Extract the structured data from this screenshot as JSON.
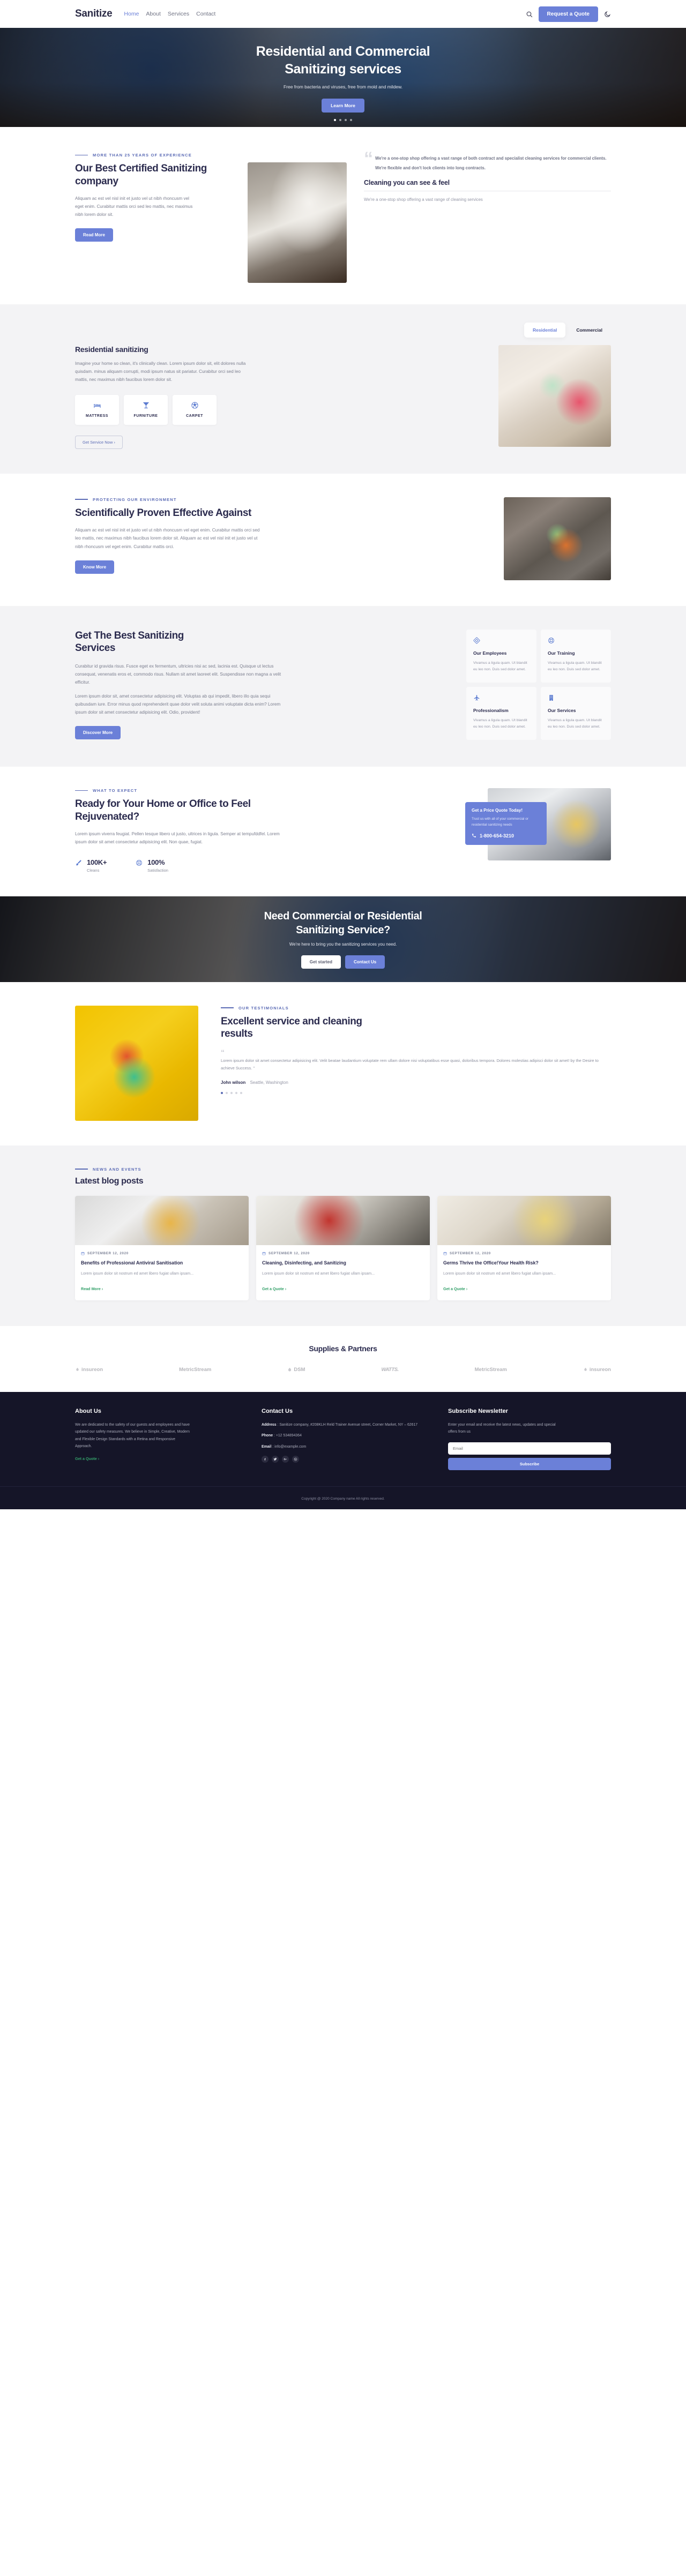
{
  "header": {
    "brand": "Sanitize",
    "nav": [
      {
        "label": "Home",
        "active": true
      },
      {
        "label": "About",
        "active": false
      },
      {
        "label": "Services",
        "active": false
      },
      {
        "label": "Contact",
        "active": false
      }
    ],
    "search_icon": "search-icon",
    "quote_button": "Request a Quote",
    "theme_icon": "moon-icon"
  },
  "hero": {
    "title_line1": "Residential and Commercial",
    "title_line2": "Sanitizing services",
    "subtitle": "Free from bacteria and viruses, free from mold and mildew.",
    "button": "Learn More",
    "slide_count": 4,
    "active_slide": 1
  },
  "about": {
    "eyebrow": "MORE THAN 25 YEARS OF EXPERIENCE",
    "title": "Our Best Certified Sanitizing company",
    "body": "Aliquam ac est vel nisl init et justo vel ut nibh rhoncusm vel eget enim. Curabitur mattis orci sed leo mattis, nec maximus nibh lorem dolor sit.",
    "button": "Read More",
    "quote_mark": "“",
    "quote": "We're a one-stop shop offering a vast range of both contract and specialist cleaning services for commercial clients. We're flexible and don't lock clients into long contracts.",
    "quote_heading": "Cleaning you can see & feel",
    "quote_sub": "We're a one-stop shop offering a vast range of cleaning services"
  },
  "residential": {
    "tabs": [
      {
        "label": "Residential",
        "active": true
      },
      {
        "label": "Commercial",
        "active": false
      }
    ],
    "title": "Residential sanitizing",
    "body": "Imagine your home so clean, it's clinically clean. Lorem ipsum dolor sit, elit dolores nulla quisdam. minus aliquam corrupti, modi ipsum natus sit pariatur. Curabitur orci sed leo mattis, nec maximus nibh faucibus lorem dolor sit.",
    "cards": [
      {
        "label": "MATTRESS",
        "icon": "bed-icon"
      },
      {
        "label": "FURNITURE",
        "icon": "cocktail-glass-icon"
      },
      {
        "label": "CARPET",
        "icon": "ball-icon"
      }
    ],
    "button": "Get Service Now ›"
  },
  "science": {
    "eyebrow": "PROTECTING OUR ENVIRONMENT",
    "title": "Scientifically Proven Effective Against",
    "body": "Aliquam ac est vel nisl init et justo vel ut nibh rhoncusm vel eget enim. Curabitur mattis orci sed leo mattis, nec maximus nibh faucibus lorem dolor sit. Aliquam ac est vel nisl init et justo vel ut nibh rhoncusm vel eget enim. Curabitur mattis orci.",
    "button": "Know More"
  },
  "best": {
    "title": "Get The Best Sanitizing Services",
    "body1": "Curabitur id gravida risus. Fusce eget ex fermentum, ultricies nisi ac sed, lacinia est. Quisque ut lectus consequat, venenatis eros et, commodo risus. Nullam sit amet laoreet elit. Suspendisse non magna a velit efficitur.",
    "body2": "Lorem ipsum dolor sit, amet consectetur adipisicing elit. Voluptas ab qui impedit, libero illo quia sequi quibusdam iure. Error minus quod reprehenderit quae dolor velit soluta animi voluptate dicta enim? Lorem ipsum dolor sit amet consectetur adipisicing elit. Odio, provident!",
    "button": "Discover More",
    "features": [
      {
        "icon": "diamond-icon",
        "title": "Our Employees",
        "text": "Vivamus a ligula quam. Ut blandit eu leo non. Duis sed dolor amet."
      },
      {
        "icon": "lifebuoy-icon",
        "title": "Our Training",
        "text": "Vivamus a ligula quam. Ut blandit eu leo non. Duis sed dolor amet."
      },
      {
        "icon": "plane-icon",
        "title": "Professionalism",
        "text": "Vivamus a ligula quam. Ut blandit eu leo non. Duis sed dolor amet."
      },
      {
        "icon": "building-icon",
        "title": "Our Services",
        "text": "Vivamus a ligula quam. Ut blandit eu leo non. Duis sed dolor amet."
      }
    ]
  },
  "ready": {
    "eyebrow": "WHAT TO EXPECT",
    "title": "Ready for Your Home or Office to Feel Rejuvenated?",
    "body": "Lorem ipsum viverra feugiat. Pellen tesque libero ut justo, ultrices in ligula. Semper at tempufddfel. Lorem ipsum dolor sit amet consectetur adipisicing elit. Non quae, fugiat.",
    "stats": [
      {
        "icon": "brush-icon",
        "value": "100K+",
        "label": "Cleans"
      },
      {
        "icon": "lifebuoy-icon",
        "value": "100%",
        "label": "Satisfaction"
      }
    ],
    "card_title": "Get a Price Quote Today!",
    "card_text": "Trust us with all of your commercial or residential sanitizing needs",
    "card_phone": "1-800-654-3210",
    "phone_icon": "phone-icon"
  },
  "cta": {
    "title_line1": "Need Commercial or Residential",
    "title_line2": "Sanitizing Service?",
    "subtitle": "We're here to bring you the sanitizing services you need.",
    "button_primary": "Get started",
    "button_secondary": "Contact Us"
  },
  "testimonials": {
    "eyebrow": "OUR TESTIMONIALS",
    "title": "Excellent service and cleaning results",
    "quote_mark": "“",
    "quote": "Lorem ipsum dolor sit amet consectetur adipisicing elit. Velit beatae laudantium voluptate rem ullam dolore nisi voluptatibus esse quasi, doloribus tempora. Dolores molestias adipisci dolor sit amet! by the Desire to achieve Success. ”",
    "author_name": "John wilson",
    "author_location": "Seattle, Washington",
    "dot_count": 5,
    "active_dot": 1
  },
  "blog": {
    "eyebrow": "NEWS AND EVENTS",
    "title": "Latest blog posts",
    "posts": [
      {
        "date": "SEPTEMBER 12, 2020",
        "title": "Benefits of Professional Antiviral Sanitisation",
        "excerpt": "Lorem ipsum dolor sit nostrum ed amet libero fugiat ullam ipsam...",
        "link": "Read More ›"
      },
      {
        "date": "SEPTEMBER 12, 2020",
        "title": "Cleaning, Disinfecting, and Sanitizing",
        "excerpt": "Lorem ipsum dolor sit nostrum ed amet libero fugiat ullam ipsam...",
        "link": "Get a Quote ›"
      },
      {
        "date": "SEPTEMBER 12, 2020",
        "title": "Germs Thrive the Office!Your Health Risk?",
        "excerpt": "Lorem ipsum dolor sit nostrum ed amet libero fugiat ullam ipsam...",
        "link": "Get a Quote ›"
      }
    ],
    "calendar_icon": "calendar-icon"
  },
  "partners": {
    "title": "Supplies & Partners",
    "logos": [
      "insureon",
      "MetricStream",
      "DSM",
      "WATTS.",
      "MetricStream",
      "insureon"
    ]
  },
  "footer": {
    "about_title": "About Us",
    "about_text": "We are dedicated to the safety of our guests and employees and have updated our safety measures. We believe in Simple, Creative, Modern and Flexible Design Standards with a Retina and Responsive Approach.",
    "about_link": "Get a Quote ›",
    "contact_title": "Contact Us",
    "address_label": "Address",
    "address_value": "Sanitize company, #208KLH Reld Trainer Avenue street, Corner Market, NY – 62617",
    "phone_label": "Phone",
    "phone_value": "+12 534894364",
    "email_label": "Email",
    "email_value": "info@example.com",
    "socials": [
      "facebook-icon",
      "twitter-icon",
      "google-plus-icon",
      "dribbble-icon"
    ],
    "newsletter_title": "Subscribe Newsletter",
    "newsletter_text": "Enter your email and receive the latest news, updates and special offers from us",
    "newsletter_placeholder": "Email",
    "newsletter_value": "",
    "newsletter_button": "Subscribe",
    "copyright": "Copyright @ 2020 Company name All rights reserved."
  },
  "colors": {
    "accent": "#6b80d8",
    "dark": "#2b2b4e",
    "footer_bg": "#151528",
    "muted": "#9496a6",
    "green_link": "#34a06a"
  }
}
